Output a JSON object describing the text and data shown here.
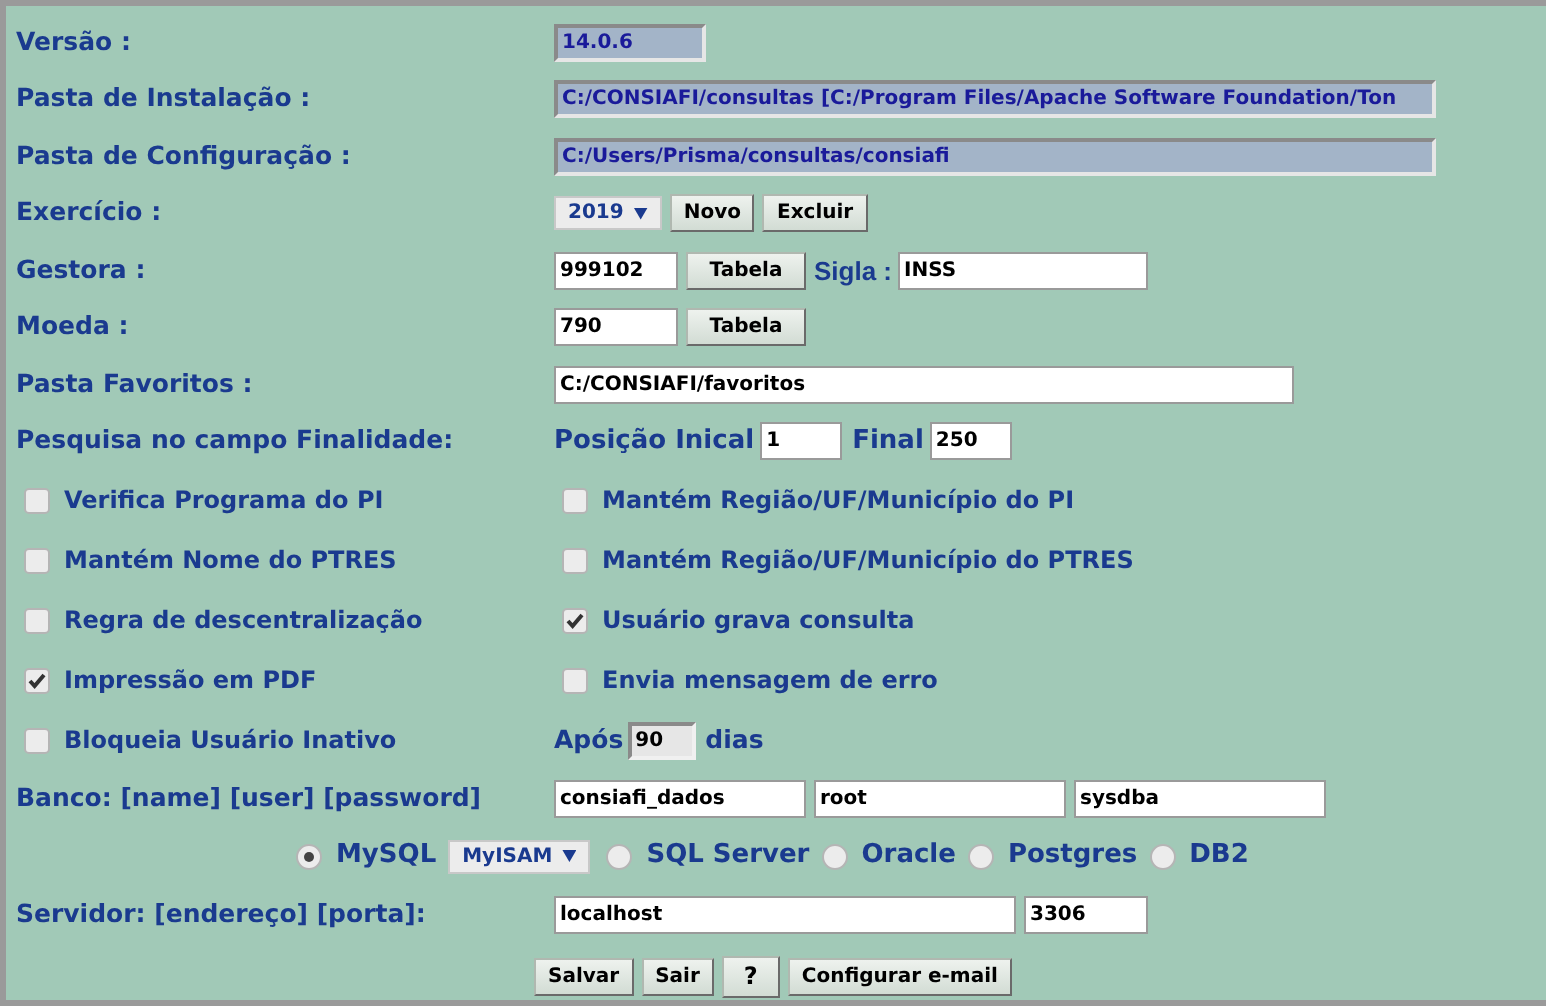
{
  "version": {
    "label": "Versão :",
    "value": "14.0.6",
    "readonly": true
  },
  "install_folder": {
    "label": "Pasta de Instalação :",
    "value": "C:/CONSIAFI/consultas [C:/Program Files/Apache Software Foundation/Ton",
    "readonly": true
  },
  "config_folder": {
    "label": "Pasta de Configuração :",
    "value": "C:/Users/Prisma/consultas/consiafi",
    "readonly": true
  },
  "exercise": {
    "label": "Exercício :",
    "year": "2019",
    "buttons": [
      "Novo",
      "Excluir"
    ]
  },
  "gestora": {
    "label": "Gestora :",
    "value": "999102",
    "button": "Tabela",
    "sigla_label": "Sigla :",
    "sigla_value": "INSS"
  },
  "moeda": {
    "label": "Moeda :",
    "value": "790",
    "button": "Tabela"
  },
  "favorites": {
    "label": "Pasta Favoritos :",
    "value": "C:/CONSIAFI/favoritos"
  },
  "search": {
    "label": "Pesquisa no campo Finalidade:",
    "start_label": "Posição Inical",
    "start_value": "1",
    "end_label": "Final",
    "end_value": "250"
  },
  "options": [
    {
      "label": "Verifica Programa do PI",
      "checked": false
    },
    {
      "label": "Mantém Região/UF/Município do PI",
      "checked": false
    },
    {
      "label": "Mantém Nome do PTRES",
      "checked": false
    },
    {
      "label": "Mantém Região/UF/Município do PTRES",
      "checked": false
    },
    {
      "label": "Regra de descentralização",
      "checked": false
    },
    {
      "label": "Usuário grava consulta",
      "checked": true
    },
    {
      "label": "Impressão em PDF",
      "checked": true
    },
    {
      "label": "Envia mensagem de erro",
      "checked": false
    },
    {
      "label": "Bloqueia Usuário Inativo",
      "checked": false
    }
  ],
  "inactive_days": {
    "prefix": "Após",
    "value": "90",
    "suffix": "dias"
  },
  "database": {
    "label": "Banco: [name] [user] [password]",
    "name": "consiafi_dados",
    "user": "root",
    "password": "sysdba"
  },
  "db_types": [
    {
      "label": "MySQL",
      "selected": true,
      "engine": "MyISAM"
    },
    {
      "label": "SQL Server",
      "selected": false
    },
    {
      "label": "Oracle",
      "selected": false
    },
    {
      "label": "Postgres",
      "selected": false
    },
    {
      "label": "DB2",
      "selected": false
    }
  ],
  "server": {
    "label": "Servidor: [endereço] [porta]:",
    "address": "localhost",
    "port": "3306"
  },
  "buttons": [
    "Salvar",
    "Sair",
    "?",
    "Configurar e-mail"
  ]
}
